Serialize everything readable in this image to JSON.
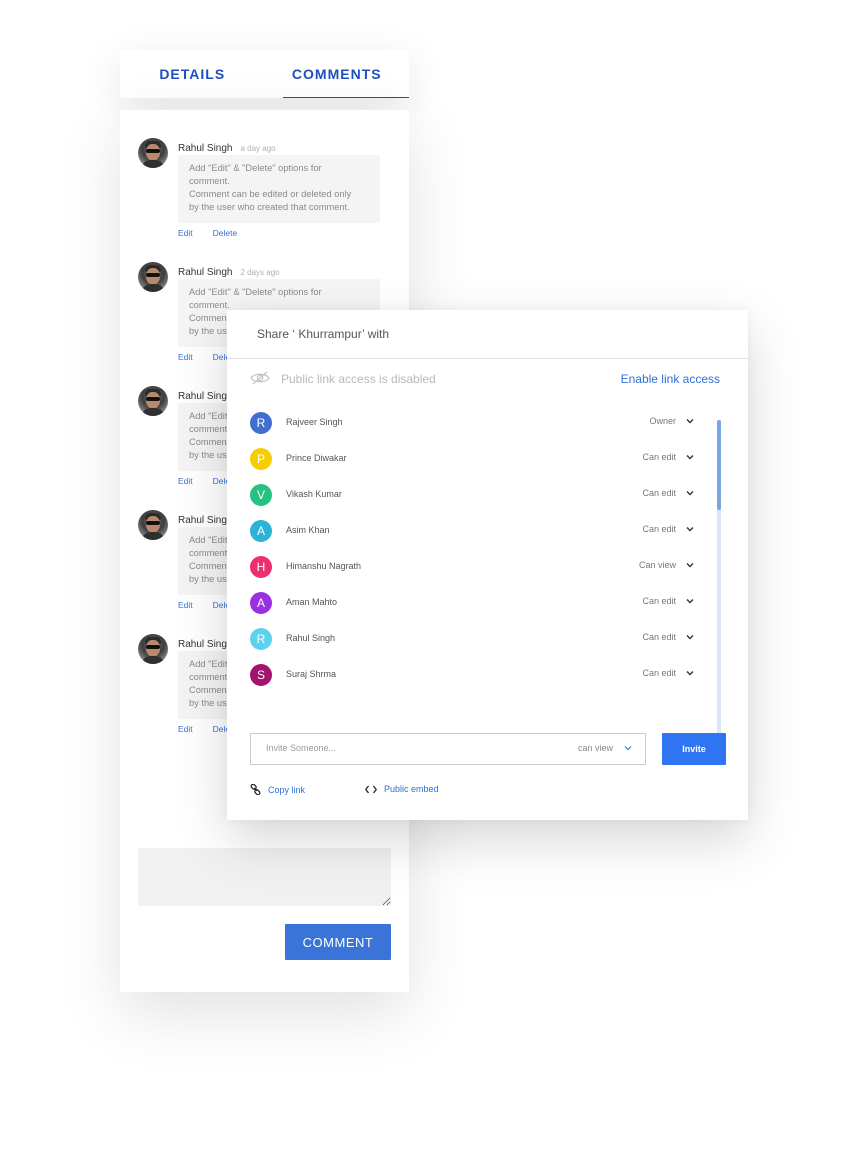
{
  "tabs": [
    {
      "label": "DETAILS",
      "active": false
    },
    {
      "label": "COMMENTS",
      "active": true
    }
  ],
  "comments": [
    {
      "name": "Rahul Singh",
      "time": "a day ago",
      "lines": [
        "Add \"Edit\" & \"Delete\" options for",
        "comment.",
        "Comment can be edited or deleted only",
        "by the user who created that comment."
      ],
      "edit": "Edit",
      "delete": "Delete"
    },
    {
      "name": "Rahul Singh",
      "time": "2 days ago",
      "lines": [
        "Add \"Edit\" & \"Delete\" options for",
        "comment.",
        "Comment can be edited or deleted only",
        "by the user who created that comment."
      ],
      "edit": "Edit",
      "delete": "Delete"
    },
    {
      "name": "Rahul Singh",
      "time": "",
      "lines": [
        "Add \"Edit\" & \"Delete\" options for",
        "comment.",
        "Comment can be edited or deleted only",
        "by the user who created that comment."
      ],
      "edit": "Edit",
      "delete": "Delete"
    },
    {
      "name": "Rahul Singh",
      "time": "",
      "lines": [
        "Add \"Edit\" & \"Delete\" options for",
        "comment.",
        "Comment can be edited or deleted only",
        "by the user who created that comment."
      ],
      "edit": "Edit",
      "delete": "Delete"
    },
    {
      "name": "Rahul Singh",
      "time": "",
      "lines": [
        "Add \"Edit\" & \"Delete\" options for",
        "comment.",
        "Comment can be edited or deleted only",
        "by the user who created that comment."
      ],
      "edit": "Edit",
      "delete": "Delete"
    }
  ],
  "comment_button": "COMMENT",
  "share": {
    "title": "Share ‘ Khurrampur’ with",
    "public_status": "Public link access is disabled",
    "public_icon": "eye-off-icon",
    "enable_link": "Enable link access",
    "members": [
      {
        "initial": "R",
        "name": "Rajveer Singh",
        "role": "Owner",
        "color": "#3f6fd0"
      },
      {
        "initial": "P",
        "name": "Prince Diwakar",
        "role": "Can edit",
        "color": "#f5cd00"
      },
      {
        "initial": "V",
        "name": "Vikash Kumar",
        "role": "Can edit",
        "color": "#26c281"
      },
      {
        "initial": "A",
        "name": "Asim Khan",
        "role": "Can edit",
        "color": "#2bb3d9"
      },
      {
        "initial": "H",
        "name": "Himanshu Nagrath",
        "role": "Can view",
        "color": "#ef2e6e"
      },
      {
        "initial": "A",
        "name": "Aman Mahto",
        "role": "Can edit",
        "color": "#9b30e3"
      },
      {
        "initial": "R",
        "name": "Rahul Singh",
        "role": "Can edit",
        "color": "#5bd2f0"
      },
      {
        "initial": "S",
        "name": "Suraj Shrma",
        "role": "Can edit",
        "color": "#a3126e"
      }
    ],
    "invite_placeholder": "Invite Someone...",
    "invite_role": "can view",
    "invite_button": "Invite",
    "copy_link": "Copy link",
    "public_embed": "Public embed"
  }
}
